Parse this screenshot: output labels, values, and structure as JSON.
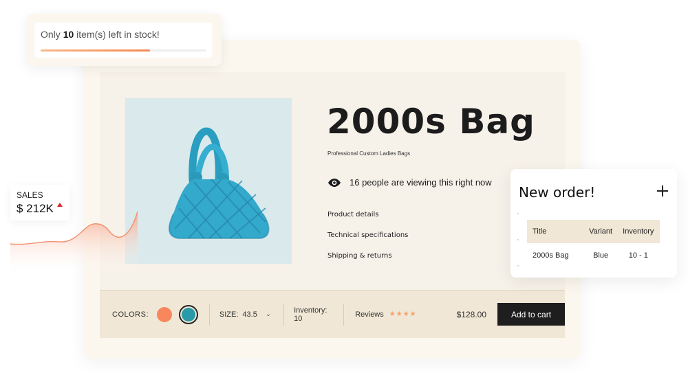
{
  "stock": {
    "prefix": "Only ",
    "count": "10",
    "suffix": " item(s) left in stock!",
    "progress_fraction": 0.66
  },
  "sales": {
    "label": "SALES",
    "value": "$ 212K"
  },
  "product": {
    "title": "2000s Bag",
    "subtitle": "Professional Custom Ladies Bags",
    "viewers": "16 people are viewing this right now",
    "links": [
      "Product details",
      "Technical specifications",
      "Shipping & returns"
    ]
  },
  "bar": {
    "colors_label": "COLORS:",
    "size_label": "SIZE:",
    "size_value": "43.5",
    "inventory": "Inventory: 10",
    "reviews_label": "Reviews",
    "stars": "★★★★",
    "price": "$128.00",
    "cart_label": "Add to cart"
  },
  "order": {
    "title": "New order!",
    "headers": [
      "Title",
      "Variant",
      "Inventory"
    ],
    "row": [
      "2000s Bag",
      "Blue",
      "10 - 1"
    ]
  },
  "colors": {
    "accent_orange": "#f8875e",
    "bag_blue": "#2b9aa8"
  }
}
